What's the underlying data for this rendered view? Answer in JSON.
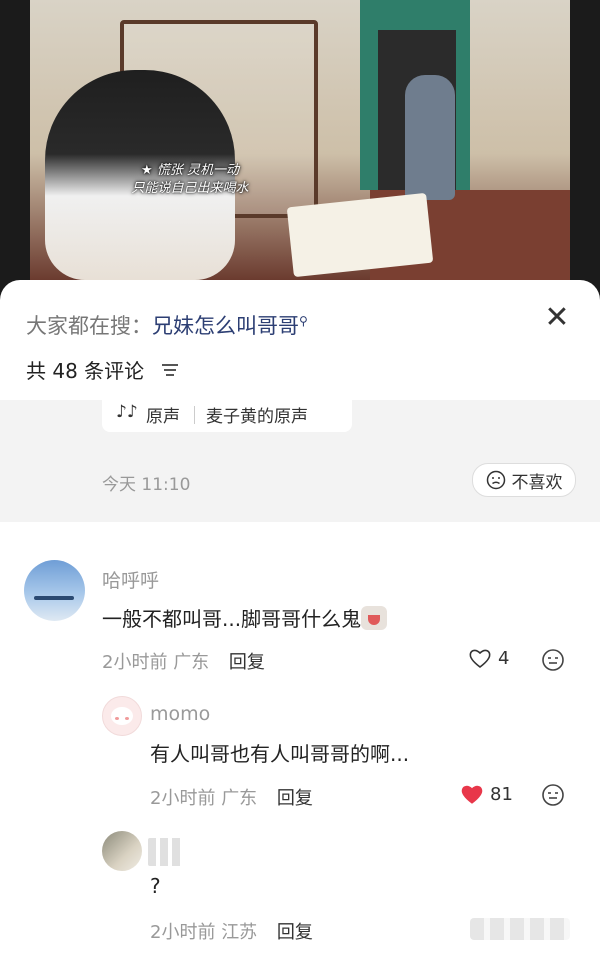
{
  "video": {
    "subtitle_lines": [
      "★ 慌张 灵机一动",
      "只能说自己出来喝水"
    ]
  },
  "search_bar": {
    "prefix": "大家都在搜：",
    "query": "兄妹怎么叫哥哥",
    "search_icon": "search-icon",
    "close_icon": "close-icon"
  },
  "comments_header": {
    "count_label": "共 48 条评论",
    "sort_icon": "sort-icon"
  },
  "sound_chip": {
    "note_icon": "music-note-icon",
    "label": "原声",
    "name": "麦子黄的原声"
  },
  "post_meta": {
    "timestamp": "今天 11:10",
    "dislike_label": "不喜欢",
    "dislike_icon": "sad-face-icon"
  },
  "comments": [
    {
      "username": "哈呼呼",
      "text": "一般不都叫哥...脚哥哥什么鬼",
      "time": "2小时前",
      "location": "广东",
      "reply_label": "回复",
      "likes": "4",
      "liked": false
    },
    {
      "username": "momo",
      "text": "有人叫哥也有人叫哥哥的啊...",
      "time": "2小时前",
      "location": "广东",
      "reply_label": "回复",
      "likes": "81",
      "liked": true
    },
    {
      "username": "",
      "text": "?",
      "time": "2小时前",
      "location": "江苏",
      "reply_label": "回复"
    }
  ],
  "colors": {
    "accent_link": "#2c3e73",
    "like_red": "#e8374a",
    "meta_gray": "#999999"
  }
}
